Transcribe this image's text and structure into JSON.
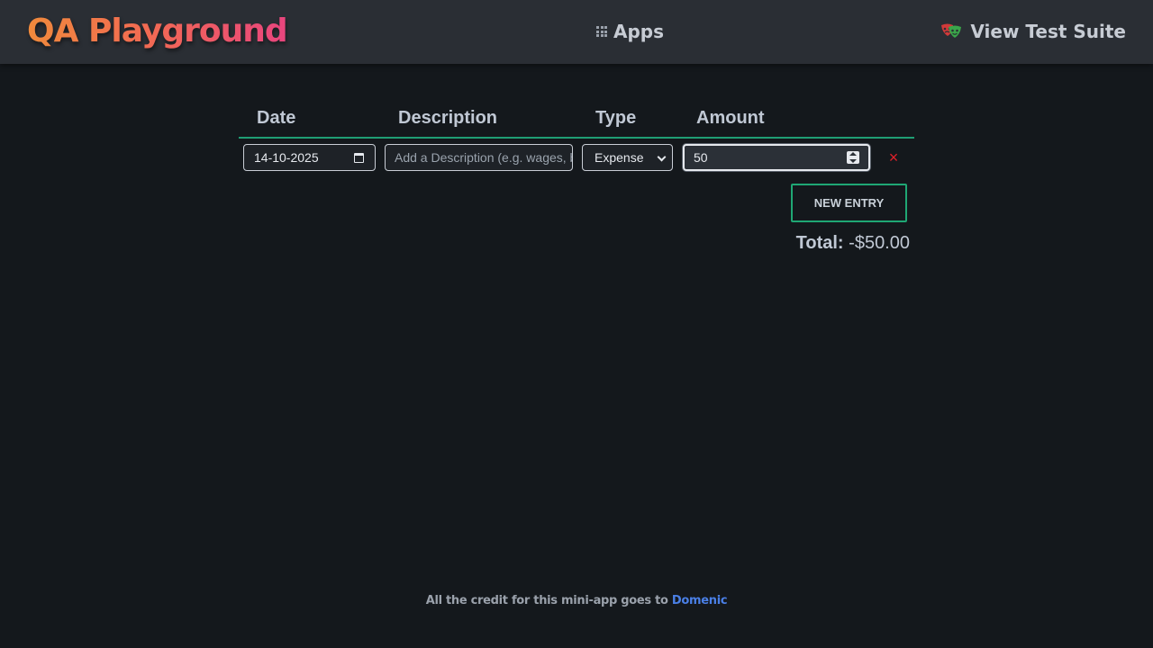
{
  "header": {
    "logo": "QA Playground",
    "apps_label": "Apps",
    "suite_label": "View Test Suite"
  },
  "table": {
    "columns": [
      "Date",
      "Description",
      "Type",
      "Amount"
    ],
    "rows": [
      {
        "date": "14-10-2025",
        "description": "",
        "description_placeholder": "Add a Description (e.g. wages, b",
        "type": "Expense",
        "amount": "50",
        "delete_icon": "×"
      }
    ]
  },
  "actions": {
    "new_entry_label": "NEW ENTRY"
  },
  "summary": {
    "total_label": "Total:",
    "total_value": "-$50.00"
  },
  "footer": {
    "credit_text": "All the credit for this mini-app goes to",
    "credit_link": "Domenic"
  },
  "colors": {
    "accent_green": "#1fa774",
    "delete_red": "#e0202a",
    "link_blue": "#4a7fe6",
    "logo_gradient_start": "#f08a3c",
    "logo_gradient_end": "#e8457e"
  },
  "icons": {
    "apps": "grid-icon",
    "suite": "theater-masks-icon",
    "date": "calendar-icon",
    "select": "chevron-down-icon",
    "amount": "spinner-icon",
    "delete": "close-icon"
  }
}
